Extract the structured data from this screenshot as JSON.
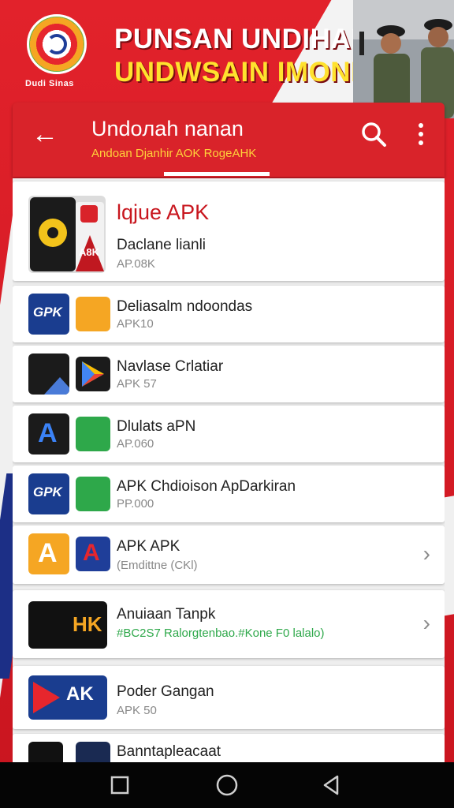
{
  "banner": {
    "logo_text": "Dudi Sinas",
    "title_line1": "PUNSAN UNDIHAN",
    "title_line2": "UNDWSAIN IMONESIA"
  },
  "appbar": {
    "back_icon": "arrow-left-icon",
    "title": "Undoлah nanan",
    "subtitle": "Andoan Djanhir AOK RogeAHK",
    "search_icon": "search-icon",
    "more_icon": "more-vert-icon"
  },
  "featured": {
    "title": "lqjue APK",
    "name": "Daclane lianli",
    "sub": "AP.08K",
    "badge": "A8K"
  },
  "items": [
    {
      "name": "Deliasalm ndoondas",
      "sub": "APK10",
      "icon1": "GPK",
      "icon2": ""
    },
    {
      "name": "Navlase Crlatiar",
      "sub": "APK 57",
      "icon1": "",
      "icon2": ""
    },
    {
      "name": "Dlulats aPN",
      "sub": "AP.060",
      "icon1": "A",
      "icon2": ""
    },
    {
      "name": "APK Chdioison ApDarkiran",
      "sub": "PP.000",
      "icon1": "GPK",
      "icon2": ""
    },
    {
      "name": "APK APK",
      "sub": "(Emdittne (CKl)",
      "icon1": "A",
      "icon2": "A"
    },
    {
      "name": "Anuiaan Tanpk",
      "sub": "#BC2S7 Ralorgtenbao.#Kone F0 lalalo)",
      "icon1": "HK",
      "icon2": ""
    },
    {
      "name": "Poder Gangan",
      "sub": "APK 50",
      "icon1": "AK",
      "icon2": ""
    },
    {
      "name": "Banntaplеacaat",
      "sub": "",
      "icon1": "",
      "icon2": ""
    }
  ],
  "colors": {
    "brand_red": "#d9232a",
    "subtitle_yellow": "#ffd23a",
    "sub_green": "#2ea84a"
  },
  "navbar": {
    "recents_icon": "square-icon",
    "home_icon": "circle-icon",
    "back_icon": "triangle-back-icon"
  }
}
